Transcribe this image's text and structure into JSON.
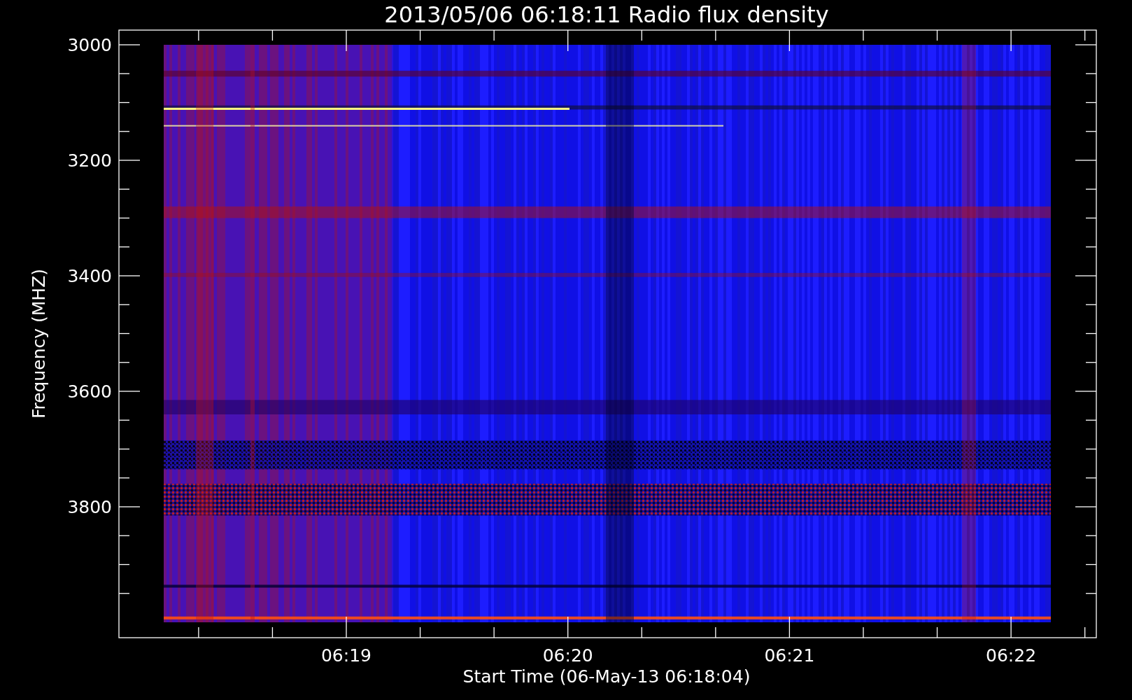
{
  "title": "2013/05/06 06:18:11 Radio flux density",
  "y_axis": {
    "label": "Frequency (MHZ)",
    "ticks": [
      "3000",
      "3200",
      "3400",
      "3600",
      "3800"
    ]
  },
  "x_axis": {
    "label": "Start Time (06-May-13 06:18:04)",
    "ticks": [
      "06:19",
      "06:20",
      "06:21",
      "06:22"
    ]
  }
}
